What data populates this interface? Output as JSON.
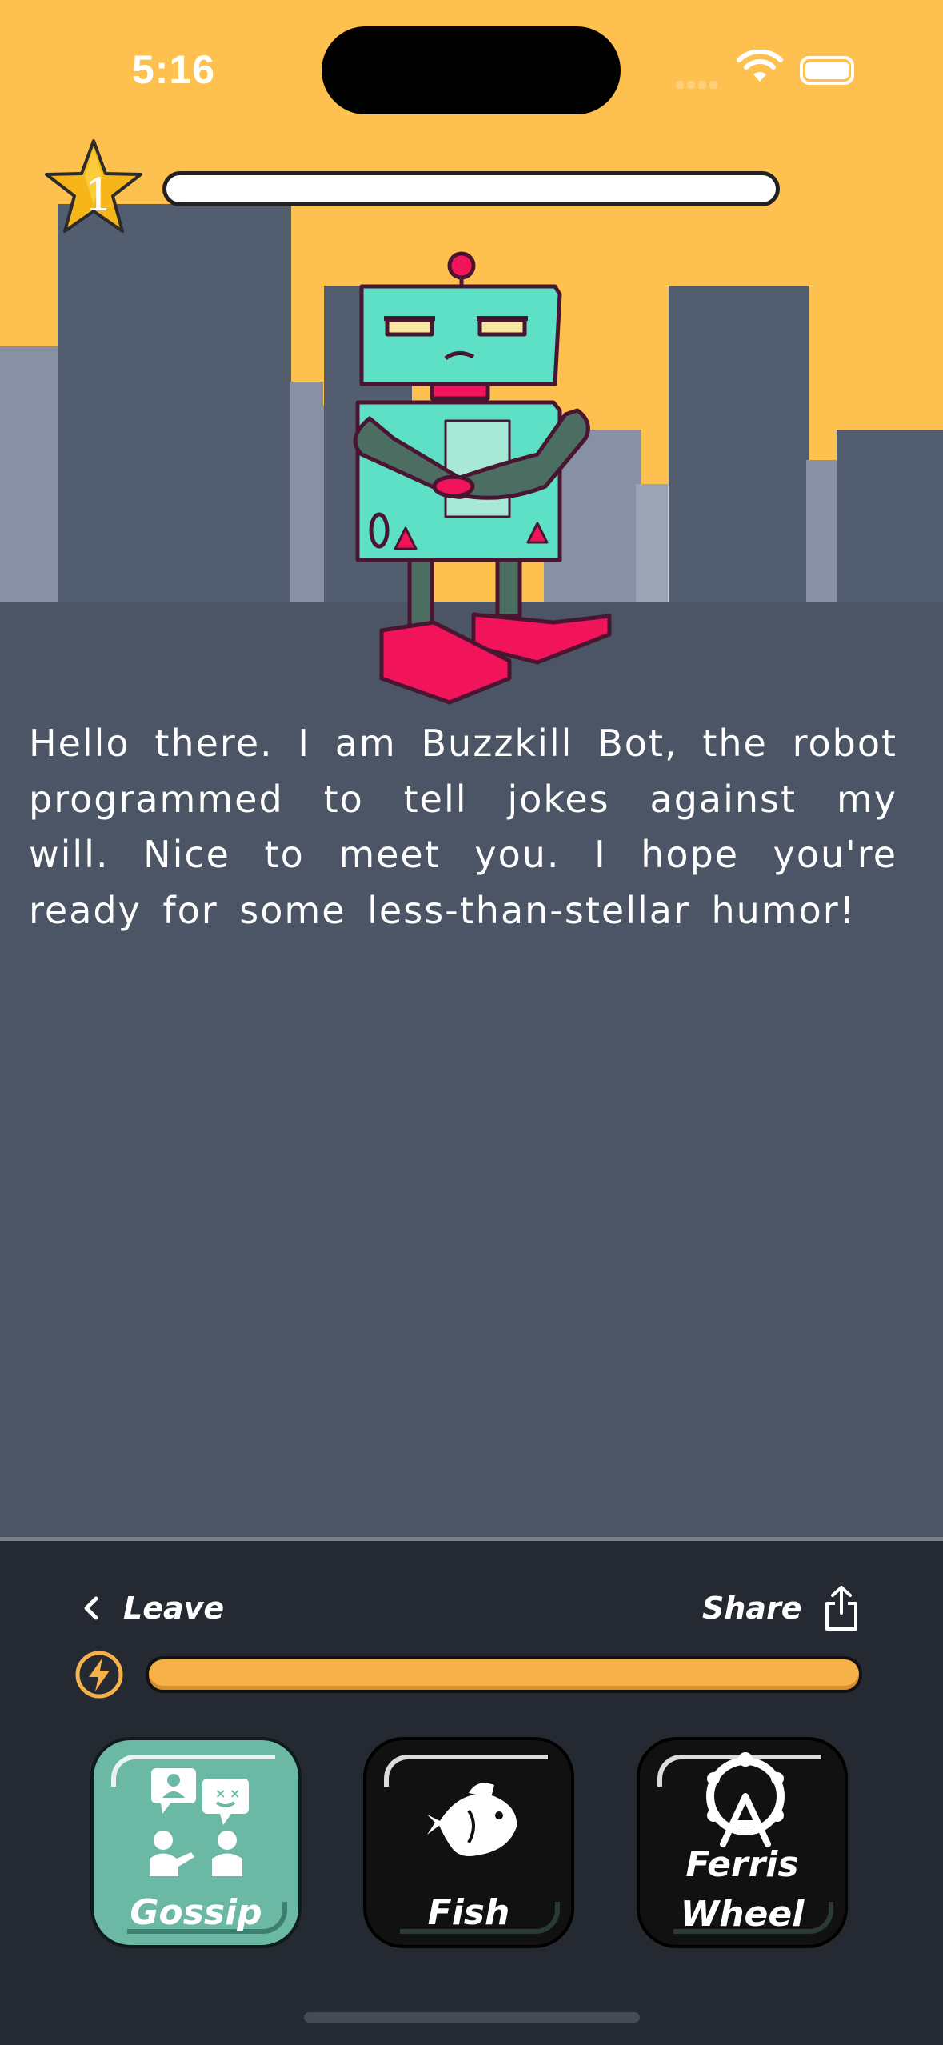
{
  "status_bar": {
    "time": "5:16"
  },
  "level": {
    "value": "1",
    "icon": "star-icon"
  },
  "robot": {
    "name": "Buzzkill Bot",
    "icon": "robot-illustration"
  },
  "message": {
    "text": "Hello there. I am Buzzkill Bot, the robot programmed to tell jokes against my will. Nice to meet you. I hope you're ready for some less-than-stellar humor!"
  },
  "nav": {
    "leave_label": "Leave",
    "share_label": "Share"
  },
  "energy": {
    "icon": "lightning-icon",
    "level": 1.0
  },
  "activities": [
    {
      "label": "Gossip",
      "icon": "gossip-people-icon",
      "selected": true
    },
    {
      "label": "Fish",
      "icon": "fish-icon",
      "selected": false
    },
    {
      "label_line1": "Ferris",
      "label_line2": "Wheel",
      "icon": "ferris-wheel-icon",
      "selected": false
    }
  ],
  "colors": {
    "sky": "#fec04f",
    "ground": "#4b5565",
    "panel": "#252932",
    "energy": "#f7b149",
    "selected": "#6bb9a4",
    "robot_body": "#5de0c6",
    "robot_feet": "#f2145a"
  }
}
